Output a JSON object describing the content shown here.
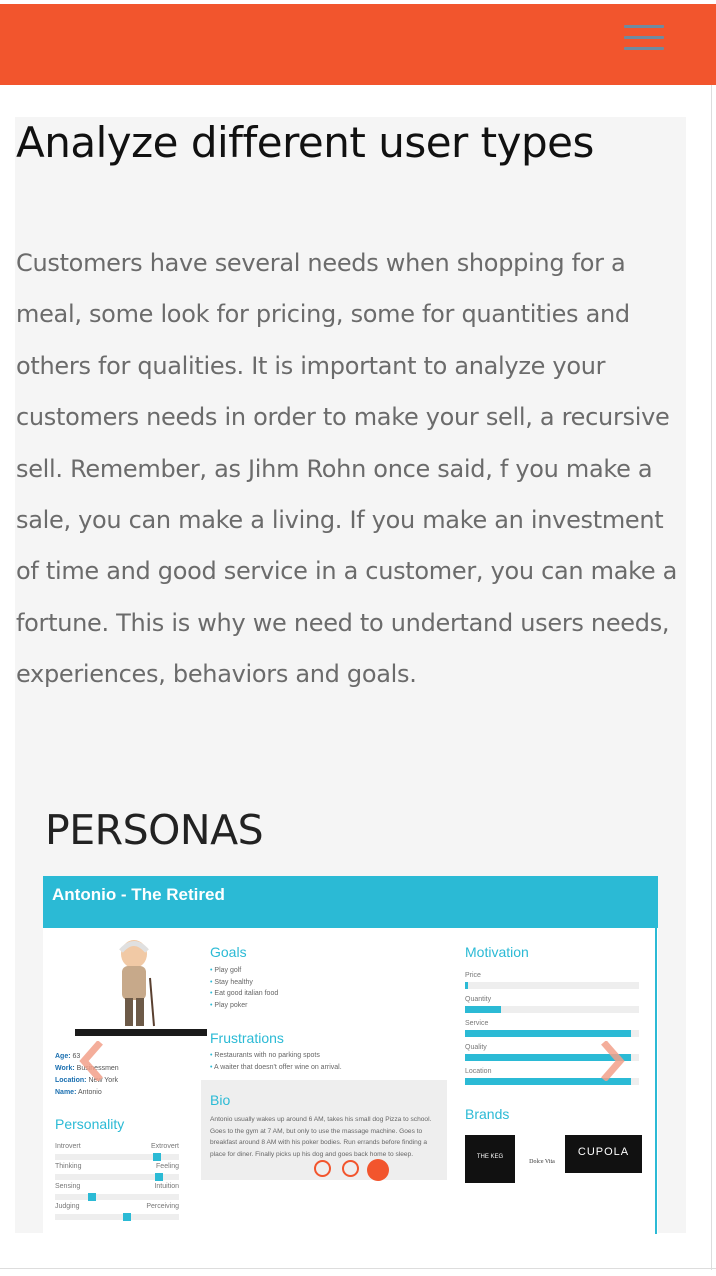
{
  "header": {
    "menu_icon": "hamburger-menu-icon",
    "color": "#f2552d"
  },
  "section": {
    "title": "Analyze different user types",
    "body": "Customers have several needs when shopping for a meal, some look for pricing, some for quantities and others for qualities. It is important to analyze your customers needs in order to make your sell, a recursive sell. Remember, as Jihm Rohn once said, f you make a sale, you can make a living. If you make an investment of time and good service in a customer, you can make a fortune. This is why we need to undertand users needs, experiences, behaviors and goals."
  },
  "personas": {
    "heading": "PERSONAS",
    "card": {
      "name": "Antonio - The Retired",
      "meta": [
        {
          "k": "Age:",
          "v": "63"
        },
        {
          "k": "Work:",
          "v": "Businessmen"
        },
        {
          "k": "Location:",
          "v": "New York"
        },
        {
          "k": "Name:",
          "v": "Antonio"
        }
      ],
      "goals_title": "Goals",
      "goals": [
        "Play golf",
        "Stay healthy",
        "Eat good italian food",
        "Play poker"
      ],
      "frustrations_title": "Frustrations",
      "frustrations": [
        "Restaurants with no parking spots",
        "A waiter that doesn't offer wine on arrival."
      ],
      "bio_title": "Bio",
      "bio": "Antonio usually wakes up around 6 AM, takes his small dog Pizza to school. Goes to the gym at 7 AM, but only to use the massage machine. Goes to breakfast around 8 AM with his poker bodies. Run errands before finding a place for diner. Finally picks up his dog and goes back home to sleep.",
      "personality_title": "Personality",
      "personality": [
        {
          "left": "Introvert",
          "right": "Extrovert",
          "level": 0.82
        },
        {
          "left": "Thinking",
          "right": "Feeling",
          "level": 0.84
        },
        {
          "left": "Sensing",
          "right": "Intuition",
          "level": 0.28
        },
        {
          "left": "Judging",
          "right": "Perceiving",
          "level": 0.58
        }
      ],
      "motivation_title": "Motivation",
      "motivation": [
        {
          "label": "Price",
          "level": 0.02
        },
        {
          "label": "Quantity",
          "level": 0.21
        },
        {
          "label": "Service",
          "level": 0.95
        },
        {
          "label": "Quality",
          "level": 0.95
        },
        {
          "label": "Location",
          "level": 0.95
        }
      ],
      "brands_title": "Brands",
      "brands": [
        "THE KEG",
        "Dolce Vita",
        "CUPOLA"
      ]
    },
    "carousel": {
      "slides": 3,
      "active": 3,
      "prev_icon": "chevron-left-icon",
      "next_icon": "chevron-right-icon"
    }
  }
}
